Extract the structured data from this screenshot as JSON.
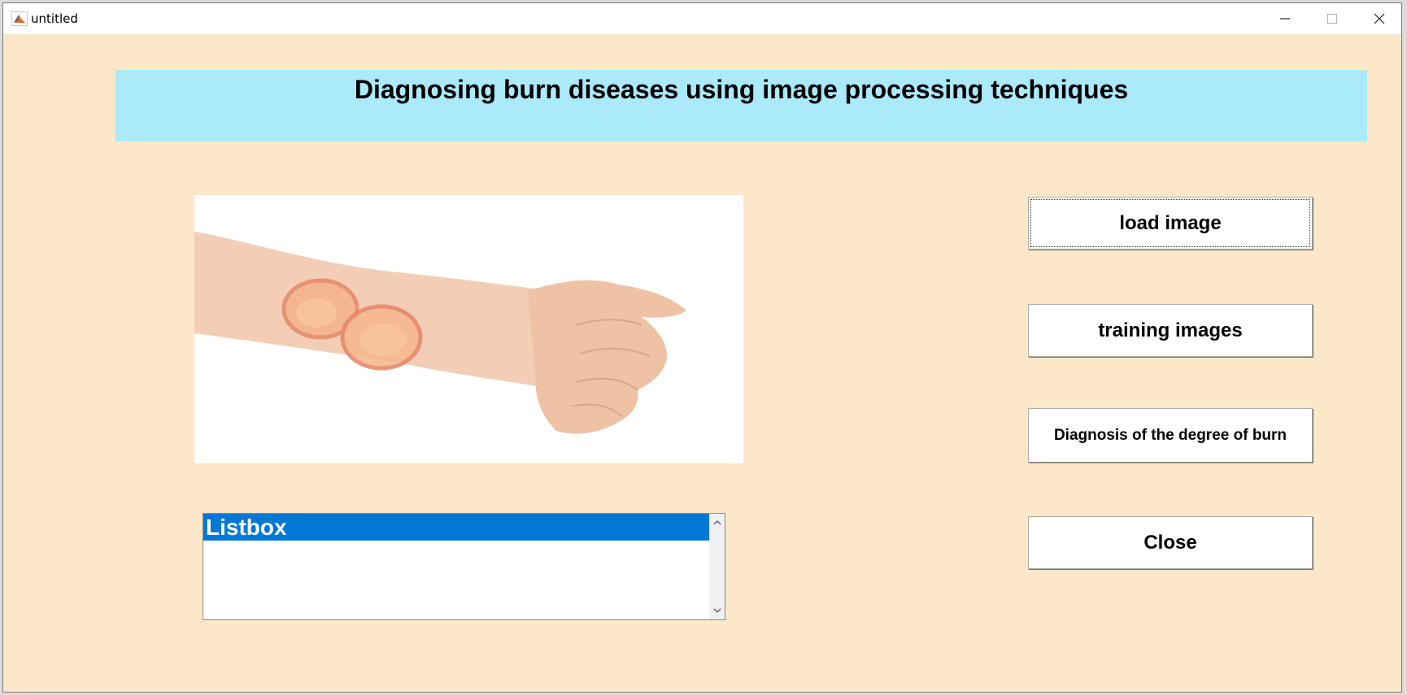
{
  "window": {
    "title": "untitled",
    "icons": {
      "app": "matlab-icon",
      "minimize": "minimize-icon",
      "maximize": "maximize-icon",
      "close": "close-icon"
    }
  },
  "header": {
    "title": "Diagnosing burn diseases using image processing techniques"
  },
  "image_panel": {
    "content": "forearm with burn mark"
  },
  "listbox": {
    "items": [
      "Listbox"
    ],
    "selected_index": 0
  },
  "buttons": {
    "load_image": "load image",
    "training_images": "training images",
    "diagnosis": "Diagnosis of the degree of burn",
    "close": "Close"
  },
  "colors": {
    "window_bg": "#fce8c9",
    "header_bg": "#aaeafa",
    "selection": "#0078d7"
  }
}
